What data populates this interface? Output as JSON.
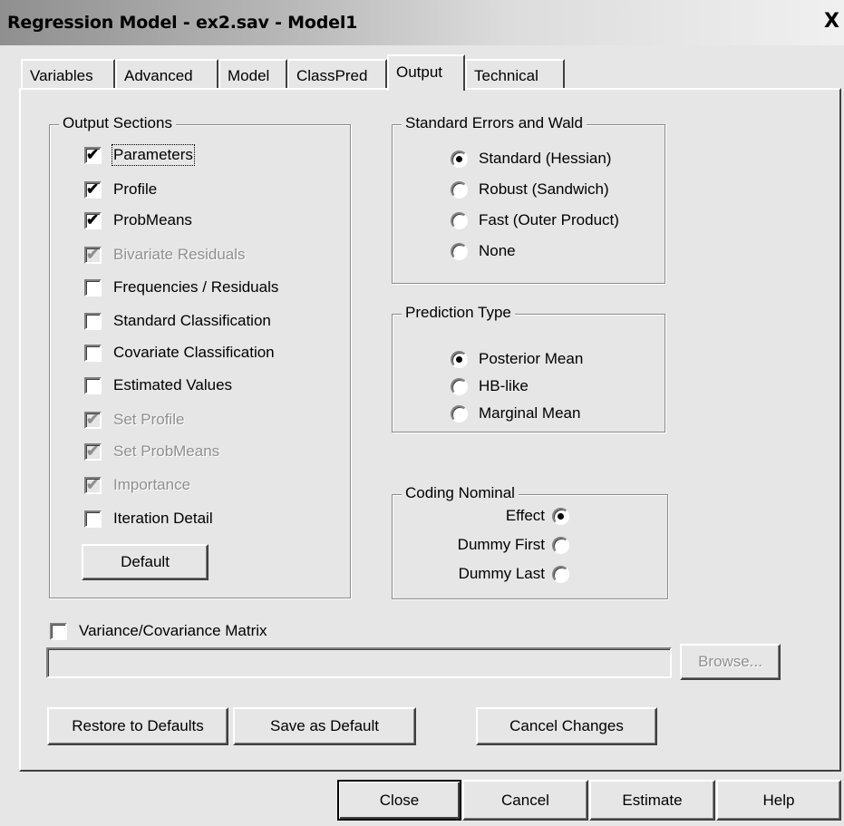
{
  "window": {
    "title": "Regression Model - ex2.sav - Model1",
    "close_glyph": "X"
  },
  "tabs": [
    {
      "label": "Variables"
    },
    {
      "label": "Advanced"
    },
    {
      "label": "Model"
    },
    {
      "label": "ClassPred"
    },
    {
      "label": "Output",
      "active": true
    },
    {
      "label": "Technical"
    }
  ],
  "output_sections": {
    "title": "Output Sections",
    "items": [
      {
        "label": "Parameters",
        "checked": true,
        "enabled": true
      },
      {
        "label": "Profile",
        "checked": true,
        "enabled": true
      },
      {
        "label": "ProbMeans",
        "checked": true,
        "enabled": true
      },
      {
        "label": "Bivariate Residuals",
        "checked": true,
        "enabled": false
      },
      {
        "label": "Frequencies / Residuals",
        "checked": false,
        "enabled": true
      },
      {
        "label": "Standard Classification",
        "checked": false,
        "enabled": true
      },
      {
        "label": "Covariate Classification",
        "checked": false,
        "enabled": true
      },
      {
        "label": "Estimated Values",
        "checked": false,
        "enabled": true
      },
      {
        "label": "Set Profile",
        "checked": true,
        "enabled": false
      },
      {
        "label": "Set ProbMeans",
        "checked": true,
        "enabled": false
      },
      {
        "label": "Importance",
        "checked": true,
        "enabled": false
      },
      {
        "label": "Iteration Detail",
        "checked": false,
        "enabled": true
      }
    ],
    "default_button": "Default"
  },
  "standard_errors": {
    "title": "Standard Errors and Wald",
    "options": [
      {
        "label": "Standard (Hessian)",
        "selected": true
      },
      {
        "label": "Robust (Sandwich)",
        "selected": false
      },
      {
        "label": "Fast (Outer Product)",
        "selected": false
      },
      {
        "label": "None",
        "selected": false
      }
    ]
  },
  "prediction_type": {
    "title": "Prediction Type",
    "options": [
      {
        "label": "Posterior Mean",
        "selected": true
      },
      {
        "label": "HB-like",
        "selected": false
      },
      {
        "label": "Marginal Mean",
        "selected": false
      }
    ]
  },
  "coding_nominal": {
    "title": "Coding Nominal",
    "options": [
      {
        "label": "Effect",
        "selected": true
      },
      {
        "label": "Dummy First",
        "selected": false
      },
      {
        "label": "Dummy Last",
        "selected": false
      }
    ]
  },
  "variance_matrix": {
    "label": "Variance/Covariance Matrix",
    "checked": false,
    "path_value": "",
    "browse_label": "Browse..."
  },
  "panel_buttons": {
    "restore": "Restore to Defaults",
    "save_default": "Save as Default",
    "cancel_changes": "Cancel Changes"
  },
  "dialog_buttons": {
    "close": "Close",
    "cancel": "Cancel",
    "estimate": "Estimate",
    "help": "Help"
  }
}
